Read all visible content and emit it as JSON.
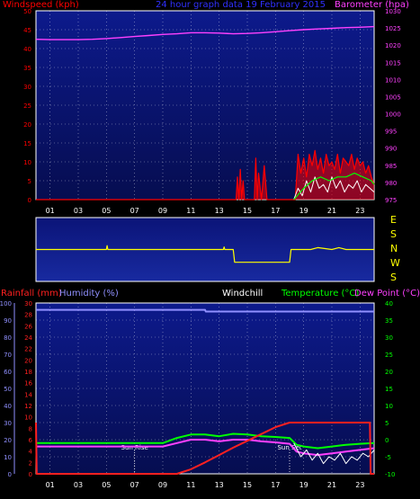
{
  "header": {
    "windspeed_label": "Windspeed (kph)",
    "title": "24 hour graph data  19 February 2015",
    "barometer_label": "Barometer (hpa)"
  },
  "bottom_header": {
    "rainfall_label": "Rainfall (mm)",
    "humidity_label": "Humidity (%)",
    "windchill_label": "Windchill",
    "temperature_label": "Temperature (°C)",
    "dewpoint_label": "Dew Point (°C)"
  },
  "compass": [
    "E",
    "S",
    "N",
    "W",
    "S"
  ],
  "annotations": {
    "sunrise": "Sun Rise",
    "sunset": "Sun Set"
  },
  "colors": {
    "background": "#000000",
    "plot": "#0b1478",
    "windspeed": "#ff0000",
    "gust": "#ffffff",
    "avg_wind": "#00ff00",
    "barometer": "#ff40ff",
    "direction": "#ffff00",
    "rain": "#ff2020",
    "humidity": "#9090ff",
    "temperature": "#00ff00",
    "dewpoint": "#ff40ff",
    "windchill": "#ffffff"
  },
  "chart_data": [
    {
      "type": "line",
      "name": "wind",
      "x_ticks": [
        "01",
        "03",
        "05",
        "07",
        "09",
        "11",
        "13",
        "15",
        "17",
        "19",
        "21",
        "23"
      ],
      "xlim": [
        0,
        24
      ],
      "ylabel_left": "Windspeed (kph)",
      "ylim_left": [
        0,
        50
      ],
      "yticks_left": [
        0,
        5,
        10,
        15,
        20,
        25,
        30,
        35,
        40,
        45,
        50
      ],
      "ylabel_right": "Barometer (hpa)",
      "ylim_right": [
        975,
        1030
      ],
      "yticks_right": [
        975,
        980,
        985,
        990,
        995,
        1000,
        1005,
        1010,
        1015,
        1020,
        1025,
        1030
      ],
      "series": [
        {
          "name": "Barometer (hpa)",
          "axis": "right",
          "x": [
            0,
            1,
            2,
            3,
            4,
            5,
            6,
            7,
            8,
            9,
            10,
            11,
            12,
            13,
            14,
            15,
            16,
            17,
            18,
            19,
            20,
            21,
            22,
            23,
            24
          ],
          "y": [
            1021.7,
            1021.6,
            1021.6,
            1021.6,
            1021.7,
            1021.9,
            1022.2,
            1022.5,
            1022.8,
            1023.1,
            1023.3,
            1023.6,
            1023.6,
            1023.5,
            1023.3,
            1023.4,
            1023.6,
            1023.9,
            1024.2,
            1024.5,
            1024.7,
            1024.9,
            1025.1,
            1025.2,
            1025.4
          ]
        },
        {
          "name": "Windspeed (kph)",
          "axis": "left",
          "x": [
            0,
            14.2,
            14.3,
            14.4,
            14.5,
            14.6,
            14.7,
            14.8,
            15.5,
            15.6,
            15.7,
            15.8,
            16.0,
            16.2,
            16.4,
            16.5,
            18.4,
            18.6,
            18.8,
            19.0,
            19.2,
            19.4,
            19.6,
            19.8,
            20.0,
            20.2,
            20.4,
            20.6,
            20.8,
            21.0,
            21.2,
            21.4,
            21.6,
            21.8,
            22.0,
            22.2,
            22.4,
            22.6,
            22.8,
            23.0,
            23.2,
            23.4,
            23.6,
            23.8,
            24
          ],
          "y": [
            0,
            0,
            6,
            0,
            8,
            0,
            5,
            0,
            0,
            11,
            0,
            7,
            0,
            9,
            0,
            0,
            0,
            12,
            7,
            11,
            6,
            12,
            9,
            13,
            8,
            11,
            7,
            12,
            9,
            10,
            8,
            12,
            7,
            11,
            10,
            9,
            12,
            8,
            11,
            9,
            10,
            7,
            9,
            6,
            4
          ]
        },
        {
          "name": "Gust",
          "axis": "left",
          "x": [
            18.3,
            18.6,
            18.9,
            19.2,
            19.5,
            19.8,
            20.1,
            20.4,
            20.7,
            21.0,
            21.3,
            21.6,
            21.9,
            22.2,
            22.5,
            22.8,
            23.1,
            23.4,
            23.7,
            24
          ],
          "y": [
            0,
            3,
            1,
            5,
            2,
            6,
            3,
            4,
            2,
            6,
            3,
            5,
            2,
            4,
            3,
            5,
            2,
            4,
            3,
            2
          ]
        },
        {
          "name": "Average wind",
          "axis": "left",
          "x": [
            18.3,
            19.0,
            19.6,
            20.2,
            20.8,
            21.4,
            22.0,
            22.6,
            23.2,
            23.8,
            24
          ],
          "y": [
            0,
            3,
            5,
            6,
            5,
            6,
            6,
            7,
            6,
            5,
            4
          ]
        }
      ]
    },
    {
      "type": "line",
      "name": "wind_direction",
      "compass": [
        "E",
        "S",
        "N",
        "W",
        "S"
      ],
      "xlim": [
        0,
        24
      ],
      "series": [
        {
          "name": "Wind direction",
          "x": [
            0,
            5.0,
            5.05,
            5.1,
            12.0,
            13.3,
            13.35,
            13.4,
            14.0,
            14.1,
            18.0,
            18.1,
            19.5,
            20.0,
            21.0,
            21.5,
            22.0,
            24
          ],
          "y": [
            2,
            2,
            1.7,
            2,
            2,
            2,
            1.8,
            2,
            2,
            3,
            3,
            2,
            2,
            1.85,
            2,
            1.85,
            2,
            2
          ]
        }
      ]
    },
    {
      "type": "line",
      "name": "climate",
      "x_ticks": [
        "01",
        "03",
        "05",
        "07",
        "09",
        "11",
        "13",
        "15",
        "17",
        "19",
        "21",
        "23"
      ],
      "xlim": [
        0,
        24
      ],
      "ylim_left": [
        0,
        100
      ],
      "yticks_left": [
        0,
        10,
        20,
        30,
        40,
        50,
        60,
        70,
        80,
        90,
        100
      ],
      "ylim_rain": [
        0,
        30
      ],
      "yticks_rain": [
        0,
        2,
        4,
        6,
        8,
        10,
        12,
        14,
        16,
        18,
        20,
        22,
        24,
        26,
        28,
        30
      ],
      "ylim_right": [
        -10,
        40
      ],
      "yticks_right": [
        -10,
        -5,
        0,
        5,
        10,
        15,
        20,
        25,
        30,
        35,
        40
      ],
      "series": [
        {
          "name": "Rainfall (mm)",
          "x": [
            0,
            0.05,
            10.0,
            11.0,
            12.0,
            13.0,
            14.0,
            15.0,
            16.0,
            17.0,
            18.0,
            19.0,
            20.0,
            21.0,
            22.0,
            23.0,
            23.7,
            23.75,
            24
          ],
          "y": [
            9,
            0,
            0,
            0.8,
            2.0,
            3.3,
            4.6,
            5.8,
            7.0,
            8.2,
            9.0,
            9.0,
            9.0,
            9.0,
            9.0,
            9.0,
            9.0,
            0,
            0
          ]
        },
        {
          "name": "Humidity (%)",
          "x": [
            0,
            12.0,
            12.05,
            24
          ],
          "y": [
            96,
            96,
            95,
            95
          ]
        },
        {
          "name": "Temperature (°C)",
          "x": [
            0,
            3,
            6,
            9,
            10,
            11,
            12,
            13,
            14,
            15,
            16,
            17,
            18,
            18.5,
            19,
            20,
            21,
            22,
            23,
            24
          ],
          "y": [
            -1,
            -1,
            -1,
            -1,
            0.5,
            1.5,
            1.5,
            1.0,
            1.7,
            1.5,
            1.0,
            0.8,
            0.5,
            -1.5,
            -2.0,
            -2.5,
            -2.0,
            -1.5,
            -1.2,
            -1
          ]
        },
        {
          "name": "Dew Point (°C)",
          "x": [
            0,
            3,
            6,
            9,
            10,
            11,
            12,
            13,
            14,
            15,
            16,
            17,
            18,
            18.5,
            19,
            20,
            21,
            22,
            23,
            24
          ],
          "y": [
            -2,
            -2,
            -2,
            -2,
            -1.0,
            0,
            0,
            -0.5,
            0,
            0,
            -0.5,
            -0.8,
            -1.2,
            -3.5,
            -4.0,
            -4.5,
            -4.0,
            -3.5,
            -3.0,
            -2.5
          ]
        },
        {
          "name": "Windchill",
          "x": [
            18.3,
            18.8,
            19.2,
            19.6,
            20.0,
            20.4,
            20.8,
            21.2,
            21.6,
            22.0,
            22.4,
            22.8,
            23.2,
            23.6,
            24
          ],
          "y": [
            -1,
            -5,
            -3,
            -6,
            -4,
            -7,
            -5,
            -6,
            -4,
            -7,
            -5,
            -6,
            -4,
            -5,
            -3
          ]
        }
      ],
      "sunrise": 7.0,
      "sunset": 18.0
    }
  ]
}
